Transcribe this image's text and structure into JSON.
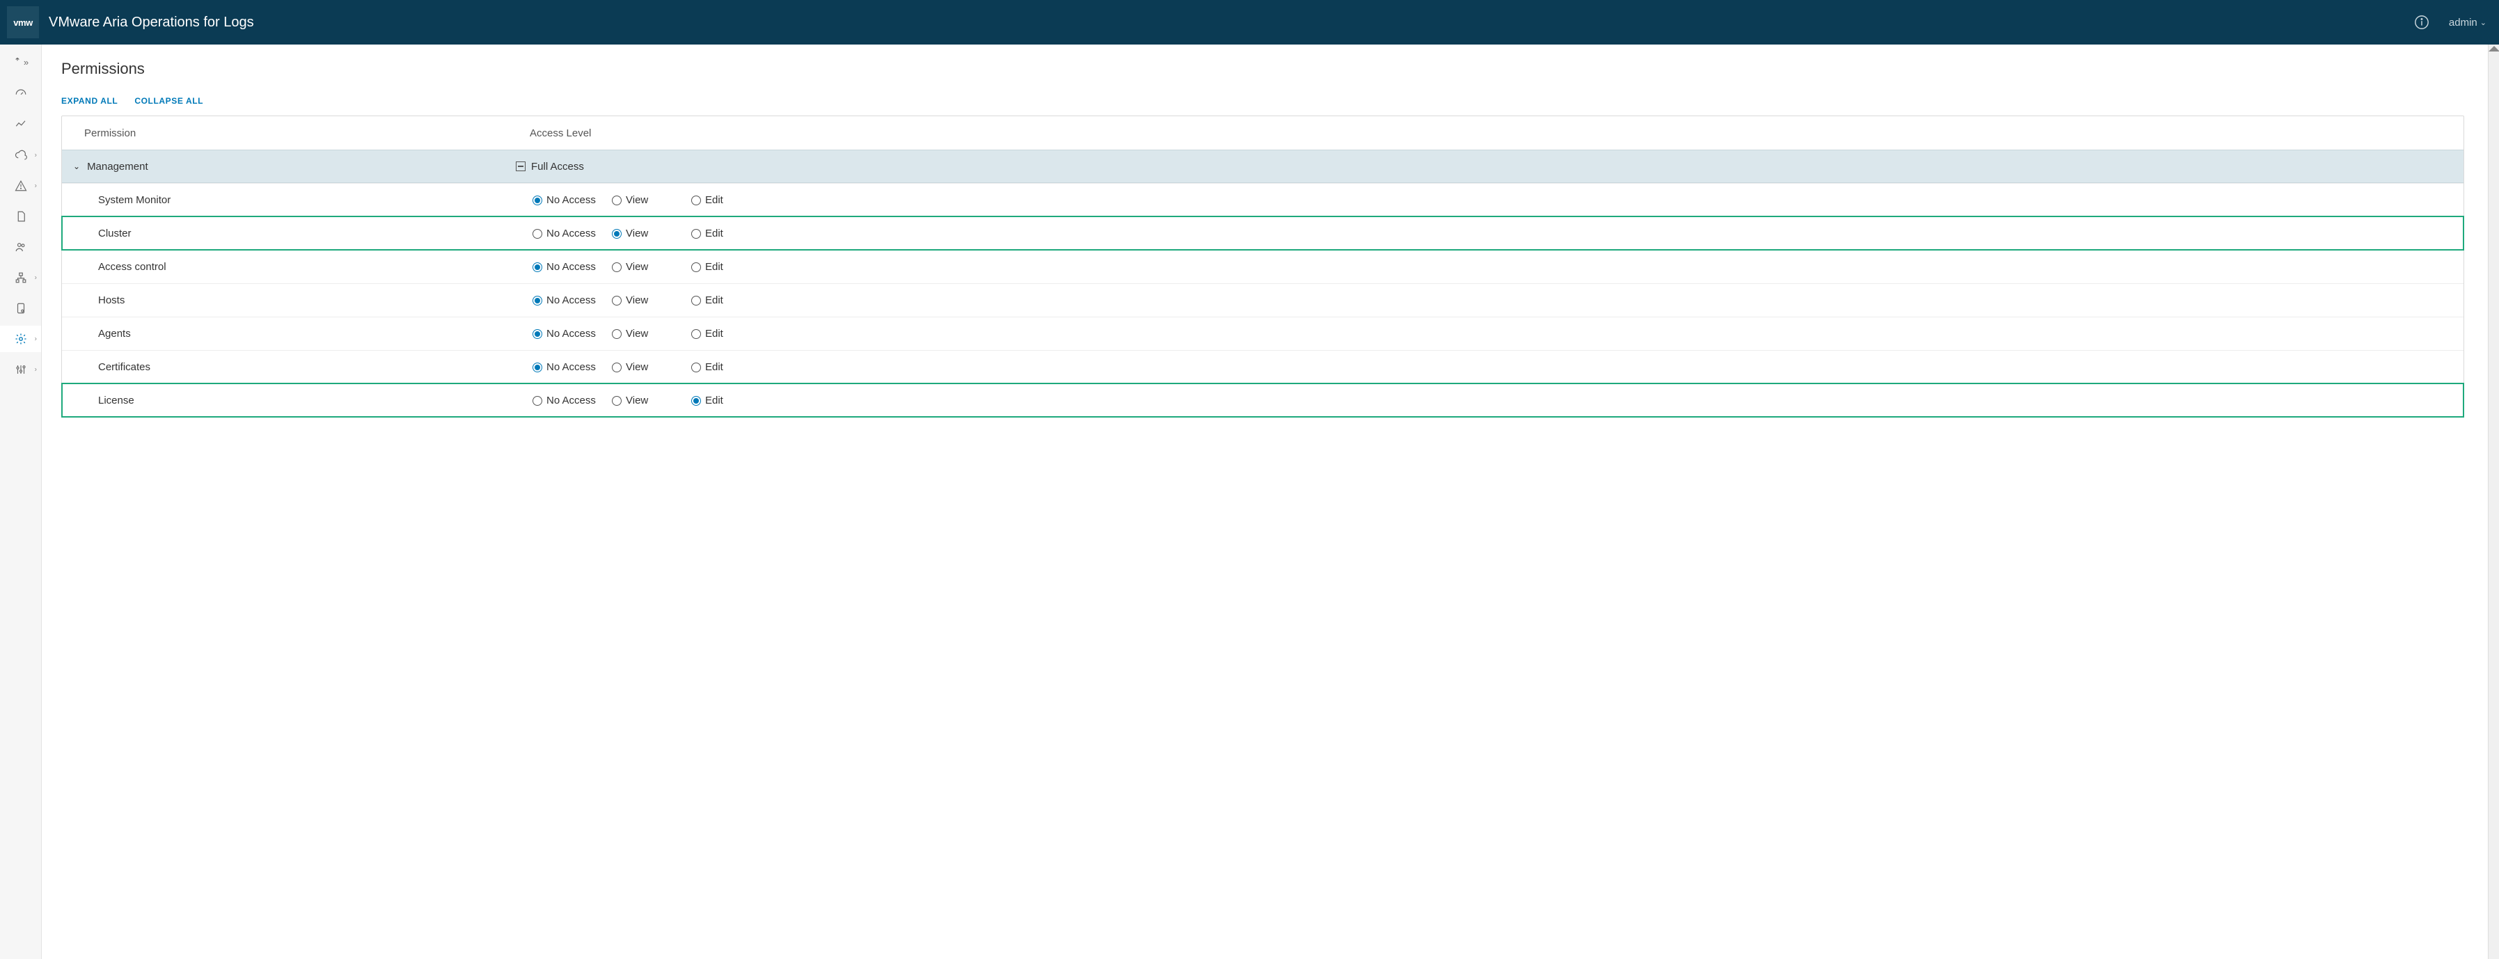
{
  "header": {
    "logo_text": "vmw",
    "product_title": "VMware Aria Operations for Logs",
    "user_label": "admin"
  },
  "page": {
    "title": "Permissions",
    "expand_all": "EXPAND ALL",
    "collapse_all": "COLLAPSE ALL"
  },
  "table": {
    "col_permission": "Permission",
    "col_access": "Access Level",
    "group": {
      "name": "Management",
      "summary": "Full Access"
    },
    "opt_noaccess": "No Access",
    "opt_view": "View",
    "opt_edit": "Edit",
    "rows": [
      {
        "label": "System Monitor",
        "selected": "noaccess",
        "highlight": false
      },
      {
        "label": "Cluster",
        "selected": "view",
        "highlight": true
      },
      {
        "label": "Access control",
        "selected": "noaccess",
        "highlight": false
      },
      {
        "label": "Hosts",
        "selected": "noaccess",
        "highlight": false
      },
      {
        "label": "Agents",
        "selected": "noaccess",
        "highlight": false
      },
      {
        "label": "Certificates",
        "selected": "noaccess",
        "highlight": false
      },
      {
        "label": "License",
        "selected": "edit",
        "highlight": true
      }
    ]
  }
}
